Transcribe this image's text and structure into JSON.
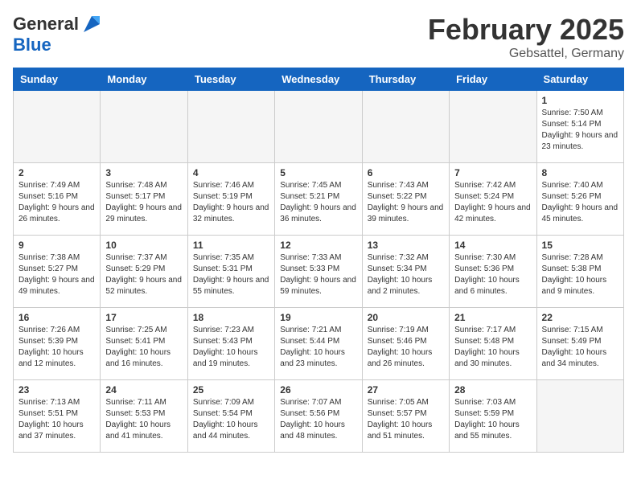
{
  "header": {
    "logo_general": "General",
    "logo_blue": "Blue",
    "month_title": "February 2025",
    "location": "Gebsattel, Germany"
  },
  "weekdays": [
    "Sunday",
    "Monday",
    "Tuesday",
    "Wednesday",
    "Thursday",
    "Friday",
    "Saturday"
  ],
  "weeks": [
    [
      {
        "day": "",
        "info": ""
      },
      {
        "day": "",
        "info": ""
      },
      {
        "day": "",
        "info": ""
      },
      {
        "day": "",
        "info": ""
      },
      {
        "day": "",
        "info": ""
      },
      {
        "day": "",
        "info": ""
      },
      {
        "day": "1",
        "info": "Sunrise: 7:50 AM\nSunset: 5:14 PM\nDaylight: 9 hours and 23 minutes."
      }
    ],
    [
      {
        "day": "2",
        "info": "Sunrise: 7:49 AM\nSunset: 5:16 PM\nDaylight: 9 hours and 26 minutes."
      },
      {
        "day": "3",
        "info": "Sunrise: 7:48 AM\nSunset: 5:17 PM\nDaylight: 9 hours and 29 minutes."
      },
      {
        "day": "4",
        "info": "Sunrise: 7:46 AM\nSunset: 5:19 PM\nDaylight: 9 hours and 32 minutes."
      },
      {
        "day": "5",
        "info": "Sunrise: 7:45 AM\nSunset: 5:21 PM\nDaylight: 9 hours and 36 minutes."
      },
      {
        "day": "6",
        "info": "Sunrise: 7:43 AM\nSunset: 5:22 PM\nDaylight: 9 hours and 39 minutes."
      },
      {
        "day": "7",
        "info": "Sunrise: 7:42 AM\nSunset: 5:24 PM\nDaylight: 9 hours and 42 minutes."
      },
      {
        "day": "8",
        "info": "Sunrise: 7:40 AM\nSunset: 5:26 PM\nDaylight: 9 hours and 45 minutes."
      }
    ],
    [
      {
        "day": "9",
        "info": "Sunrise: 7:38 AM\nSunset: 5:27 PM\nDaylight: 9 hours and 49 minutes."
      },
      {
        "day": "10",
        "info": "Sunrise: 7:37 AM\nSunset: 5:29 PM\nDaylight: 9 hours and 52 minutes."
      },
      {
        "day": "11",
        "info": "Sunrise: 7:35 AM\nSunset: 5:31 PM\nDaylight: 9 hours and 55 minutes."
      },
      {
        "day": "12",
        "info": "Sunrise: 7:33 AM\nSunset: 5:33 PM\nDaylight: 9 hours and 59 minutes."
      },
      {
        "day": "13",
        "info": "Sunrise: 7:32 AM\nSunset: 5:34 PM\nDaylight: 10 hours and 2 minutes."
      },
      {
        "day": "14",
        "info": "Sunrise: 7:30 AM\nSunset: 5:36 PM\nDaylight: 10 hours and 6 minutes."
      },
      {
        "day": "15",
        "info": "Sunrise: 7:28 AM\nSunset: 5:38 PM\nDaylight: 10 hours and 9 minutes."
      }
    ],
    [
      {
        "day": "16",
        "info": "Sunrise: 7:26 AM\nSunset: 5:39 PM\nDaylight: 10 hours and 12 minutes."
      },
      {
        "day": "17",
        "info": "Sunrise: 7:25 AM\nSunset: 5:41 PM\nDaylight: 10 hours and 16 minutes."
      },
      {
        "day": "18",
        "info": "Sunrise: 7:23 AM\nSunset: 5:43 PM\nDaylight: 10 hours and 19 minutes."
      },
      {
        "day": "19",
        "info": "Sunrise: 7:21 AM\nSunset: 5:44 PM\nDaylight: 10 hours and 23 minutes."
      },
      {
        "day": "20",
        "info": "Sunrise: 7:19 AM\nSunset: 5:46 PM\nDaylight: 10 hours and 26 minutes."
      },
      {
        "day": "21",
        "info": "Sunrise: 7:17 AM\nSunset: 5:48 PM\nDaylight: 10 hours and 30 minutes."
      },
      {
        "day": "22",
        "info": "Sunrise: 7:15 AM\nSunset: 5:49 PM\nDaylight: 10 hours and 34 minutes."
      }
    ],
    [
      {
        "day": "23",
        "info": "Sunrise: 7:13 AM\nSunset: 5:51 PM\nDaylight: 10 hours and 37 minutes."
      },
      {
        "day": "24",
        "info": "Sunrise: 7:11 AM\nSunset: 5:53 PM\nDaylight: 10 hours and 41 minutes."
      },
      {
        "day": "25",
        "info": "Sunrise: 7:09 AM\nSunset: 5:54 PM\nDaylight: 10 hours and 44 minutes."
      },
      {
        "day": "26",
        "info": "Sunrise: 7:07 AM\nSunset: 5:56 PM\nDaylight: 10 hours and 48 minutes."
      },
      {
        "day": "27",
        "info": "Sunrise: 7:05 AM\nSunset: 5:57 PM\nDaylight: 10 hours and 51 minutes."
      },
      {
        "day": "28",
        "info": "Sunrise: 7:03 AM\nSunset: 5:59 PM\nDaylight: 10 hours and 55 minutes."
      },
      {
        "day": "",
        "info": ""
      }
    ]
  ]
}
